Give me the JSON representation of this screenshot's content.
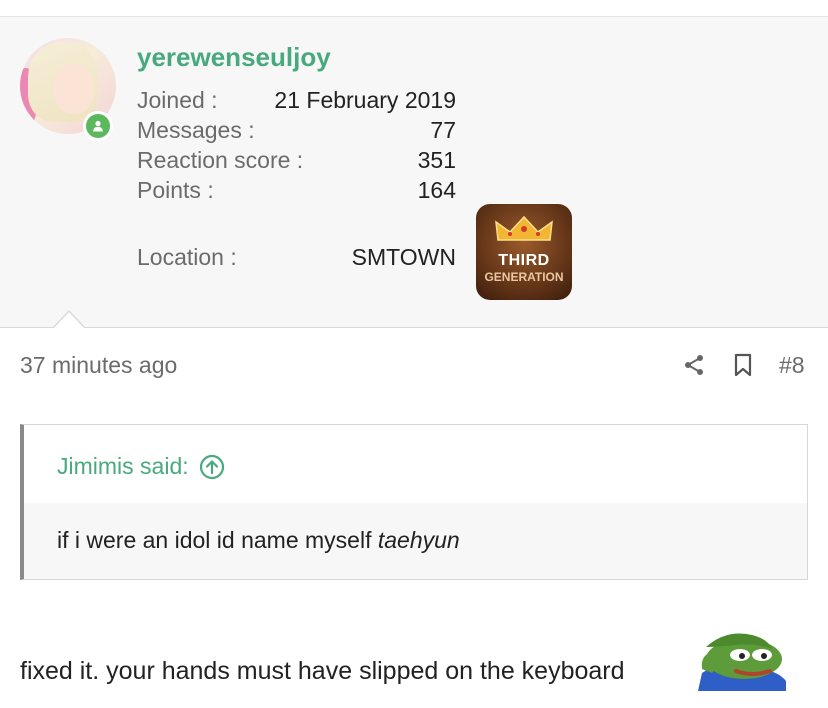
{
  "user": {
    "username": "yerewenseuljoy",
    "stats": [
      {
        "label": "Joined :",
        "value": "21 February 2019"
      },
      {
        "label": "Messages :",
        "value": "77"
      },
      {
        "label": "Reaction score :",
        "value": "351"
      },
      {
        "label": "Points :",
        "value": "164"
      }
    ],
    "location_label": "Location :",
    "location_value": "SMTOWN",
    "badge_line1": "THIRD",
    "badge_line2": "GENERATION",
    "online_icon": "person-icon"
  },
  "post": {
    "time": "37 minutes ago",
    "number": "#8",
    "quote_author": "Jimimis said:",
    "quote_text_plain": "if i were an idol id name myself ",
    "quote_text_italic": "taehyun",
    "message": "fixed it. your hands must have slipped on the keyboard"
  },
  "colors": {
    "accent": "#47a97d",
    "online": "#5cb85c",
    "panel_bg": "#f7f7f7"
  }
}
